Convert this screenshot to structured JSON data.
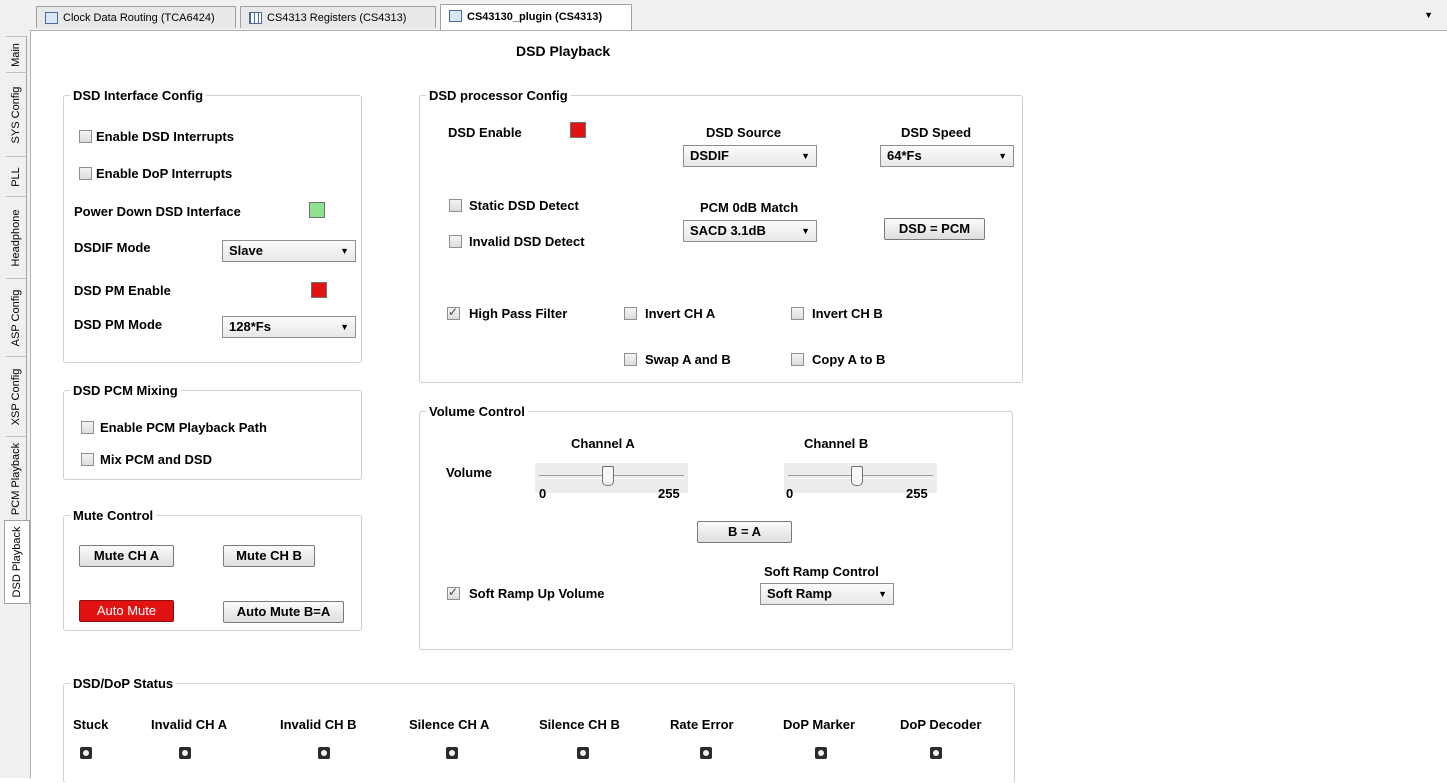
{
  "top_tabs": [
    {
      "label": "Clock Data Routing (TCA6424)"
    },
    {
      "label": "CS4313 Registers (CS4313)"
    },
    {
      "label": "CS43130_plugin (CS4313)"
    }
  ],
  "side_tabs": [
    {
      "label": "Main"
    },
    {
      "label": "SYS Config"
    },
    {
      "label": "PLL"
    },
    {
      "label": "Headphone"
    },
    {
      "label": "ASP Config"
    },
    {
      "label": "XSP Config"
    },
    {
      "label": "PCM Playback"
    },
    {
      "label": "DSD Playback"
    }
  ],
  "page_title": "DSD Playback",
  "dsd_interface_config": {
    "title": "DSD Interface Config",
    "enable_dsd_interrupts": {
      "label": "Enable DSD Interrupts",
      "checked": false
    },
    "enable_dop_interrupts": {
      "label": "Enable DoP Interrupts",
      "checked": false
    },
    "power_down_label": "Power Down DSD Interface",
    "power_down_color": "#8fe08f",
    "dsdif_mode_label": "DSDIF Mode",
    "dsdif_mode_value": "Slave",
    "dsd_pm_enable_label": "DSD PM Enable",
    "dsd_pm_enable_color": "#e21212",
    "dsd_pm_mode_label": "DSD PM Mode",
    "dsd_pm_mode_value": "128*Fs"
  },
  "dsd_pcm_mixing": {
    "title": "DSD PCM Mixing",
    "enable_pcm_playback": {
      "label": "Enable PCM Playback Path",
      "checked": false
    },
    "mix_pcm_dsd": {
      "label": "Mix PCM and DSD",
      "checked": false
    }
  },
  "mute_control": {
    "title": "Mute Control",
    "mute_ch_a": "Mute CH A",
    "mute_ch_b": "Mute CH B",
    "auto_mute": "Auto Mute",
    "auto_mute_b_a": "Auto Mute B=A"
  },
  "dsd_processor_config": {
    "title": "DSD processor Config",
    "dsd_enable_label": "DSD Enable",
    "dsd_enable_color": "#e21212",
    "dsd_source_label": "DSD Source",
    "dsd_source_value": "DSDIF",
    "dsd_speed_label": "DSD Speed",
    "dsd_speed_value": "64*Fs",
    "static_dsd_detect": {
      "label": "Static DSD Detect",
      "checked": false
    },
    "invalid_dsd_detect": {
      "label": "Invalid DSD Detect",
      "checked": false
    },
    "pcm_0db_match_label": "PCM 0dB Match",
    "pcm_0db_match_value": "SACD 3.1dB",
    "dsd_eq_pcm_button": "DSD = PCM",
    "high_pass_filter": {
      "label": "High Pass Filter",
      "checked": true
    },
    "invert_ch_a": {
      "label": "Invert CH A",
      "checked": false
    },
    "invert_ch_b": {
      "label": "Invert CH B",
      "checked": false
    },
    "swap_a_b": {
      "label": "Swap A and B",
      "checked": false
    },
    "copy_a_to_b": {
      "label": "Copy A to B",
      "checked": false
    }
  },
  "volume_control": {
    "title": "Volume Control",
    "channel_a_label": "Channel A",
    "channel_b_label": "Channel B",
    "volume_label": "Volume",
    "channel_a_min": "0",
    "channel_a_max": "255",
    "channel_b_min": "0",
    "channel_b_max": "255",
    "channel_a_level": 0.47,
    "channel_b_level": 0.47,
    "b_eq_a_button": "B = A",
    "soft_ramp_up": {
      "label": "Soft Ramp Up Volume",
      "checked": true
    },
    "soft_ramp_control_label": "Soft Ramp Control",
    "soft_ramp_control_value": "Soft Ramp"
  },
  "dsd_dop_status": {
    "title": "DSD/DoP Status",
    "items": [
      {
        "label": "Stuck"
      },
      {
        "label": "Invalid CH A"
      },
      {
        "label": "Invalid CH B"
      },
      {
        "label": "Silence CH A"
      },
      {
        "label": "Silence CH B"
      },
      {
        "label": "Rate Error"
      },
      {
        "label": "DoP Marker"
      },
      {
        "label": "DoP Decoder"
      }
    ]
  },
  "colors": {
    "led_red": "#e21212",
    "led_green": "#8fe08f"
  }
}
